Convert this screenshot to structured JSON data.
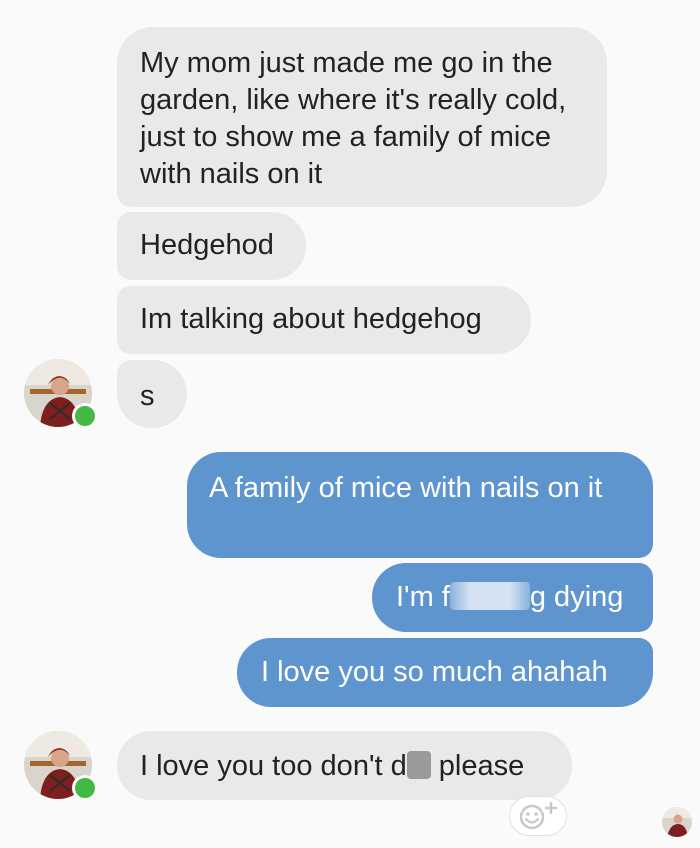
{
  "chat": {
    "messages": [
      {
        "sender": "contact",
        "text": "My mom just made me go in the garden, like where it's really cold, just to show me a family of mice with nails on it"
      },
      {
        "sender": "contact",
        "text": "Hedgehod"
      },
      {
        "sender": "contact",
        "text": "Im talking about hedgehog"
      },
      {
        "sender": "contact",
        "text": "s"
      },
      {
        "sender": "me",
        "text": "A family of mice with nails on it"
      },
      {
        "sender": "me",
        "text_before": "I'm f",
        "text_after": "g dying",
        "censored": true
      },
      {
        "sender": "me",
        "text": "I love you so much ahahah"
      },
      {
        "sender": "contact",
        "text_before": "I love you too don't d",
        "text_after": " please",
        "censored": true
      }
    ]
  },
  "icons": {
    "contact_avatar": "contact-avatar",
    "presence": "online-dot",
    "reaction": "add-reaction-icon",
    "seen": "seen-avatar"
  },
  "colors": {
    "incoming_bubble": "#e9e9e9",
    "outgoing_bubble": "#5f95cf",
    "background": "#fafafa",
    "online": "#44b844"
  }
}
